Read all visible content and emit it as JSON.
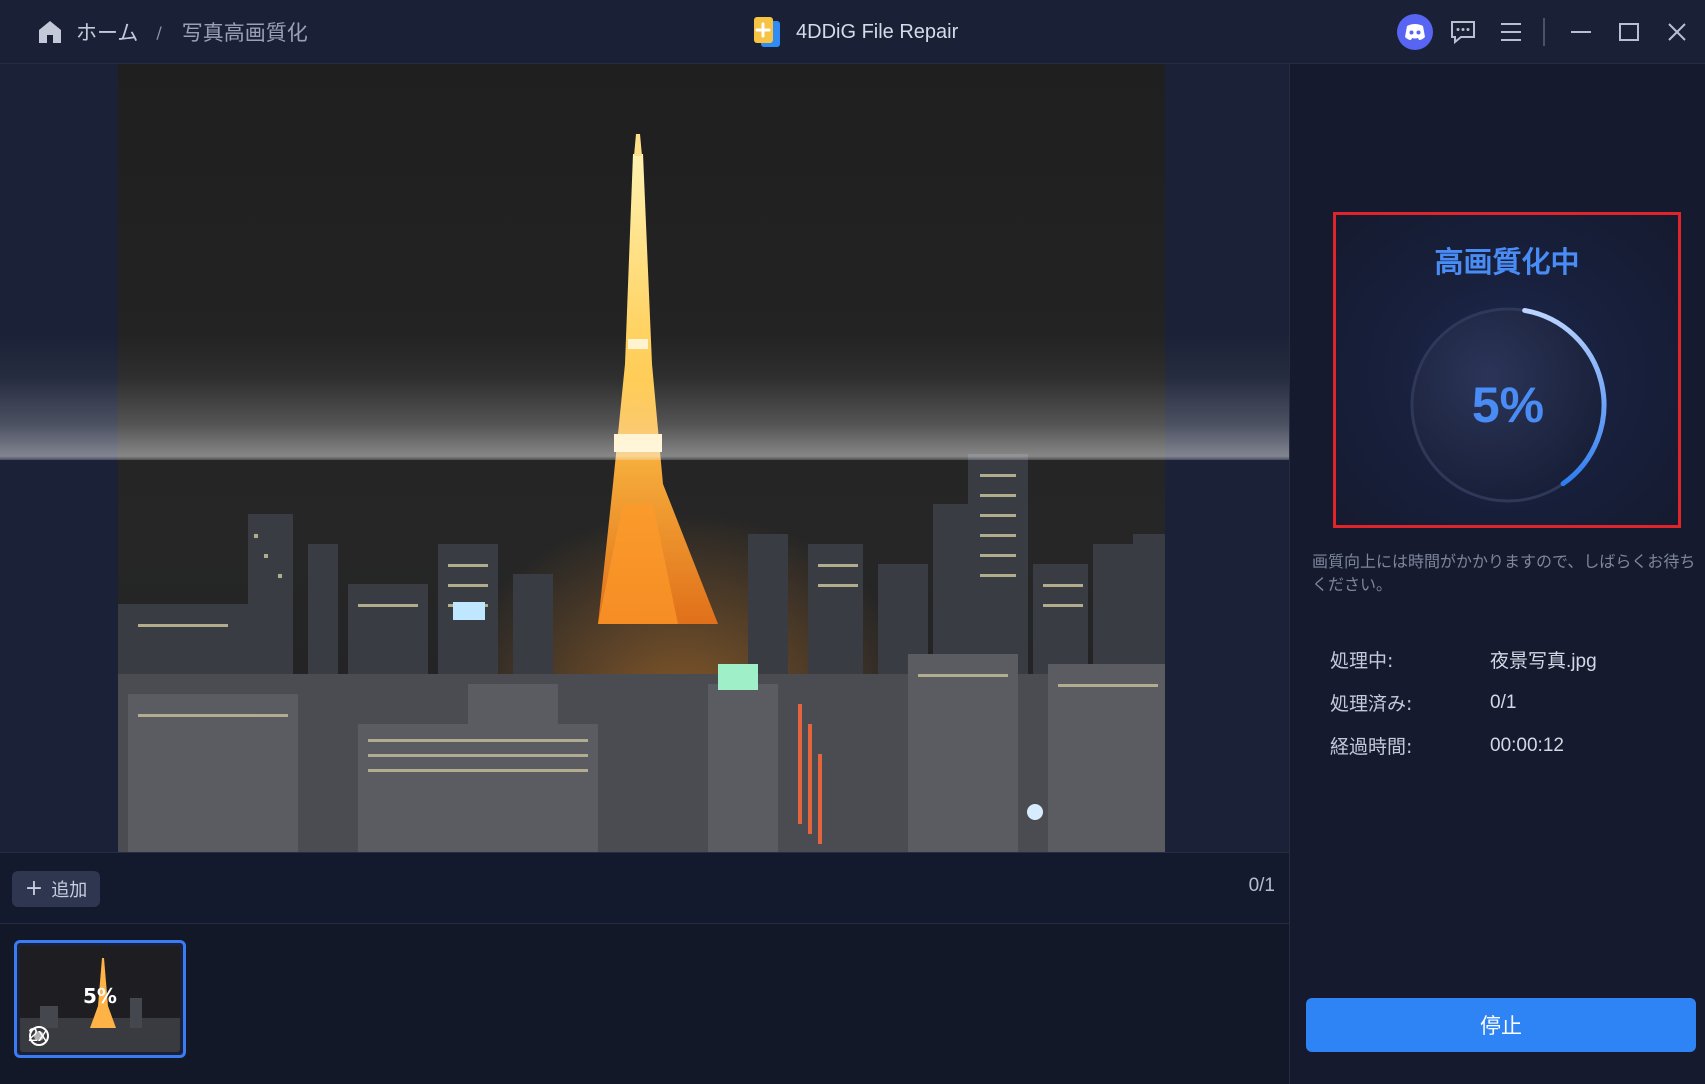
{
  "breadcrumb": {
    "home_label": "ホーム",
    "separator": "/",
    "current": "写真高画質化"
  },
  "app": {
    "title": "4DDiG File Repair"
  },
  "window_controls": [
    "discord-icon",
    "feedback-icon",
    "menu-icon",
    "minimize-icon",
    "maximize-icon",
    "close-icon"
  ],
  "toolbar": {
    "add_label": "追加",
    "counter": "0/1"
  },
  "thumbnail": {
    "progress": "5%",
    "scale": "2x"
  },
  "progress": {
    "title": "高画質化中",
    "percent_label": "5%",
    "fraction": 0.05
  },
  "hint": "画質向上には時間がかかりますので、しばらくお待ちください。",
  "status": [
    {
      "key": "処理中:",
      "value": "夜景写真.jpg"
    },
    {
      "key": "処理済み:",
      "value": "0/1"
    },
    {
      "key": "経過時間:",
      "value": "00:00:12"
    }
  ],
  "stop_label": "停止",
  "colors": {
    "accent": "#2e84f4",
    "progress_text": "#4a8cf5",
    "highlight_frame": "#e0242c"
  }
}
